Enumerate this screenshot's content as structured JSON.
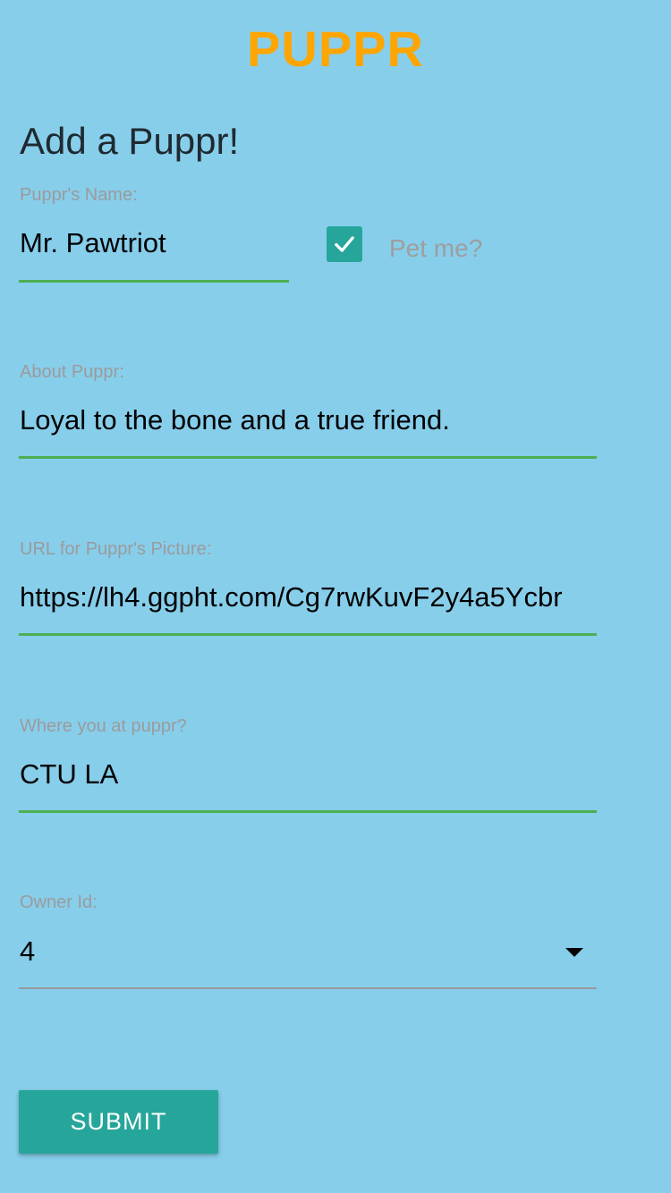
{
  "header": {
    "brand": "PUPPR"
  },
  "form": {
    "title": "Add a Puppr!",
    "name": {
      "label": "Puppr's Name:",
      "value": "Mr. Pawtriot"
    },
    "pet_me": {
      "label": "Pet me?",
      "checked": true
    },
    "about": {
      "label": "About Puppr:",
      "value": "Loyal to the bone and a true friend."
    },
    "picture_url": {
      "label": "URL for Puppr's Picture:",
      "value": "https://lh4.ggpht.com/Cg7rwKuvF2y4a5Ycbr"
    },
    "location": {
      "label": "Where you at puppr?",
      "value": "CTU LA"
    },
    "owner_id": {
      "label": "Owner Id:",
      "value": "4"
    },
    "submit_label": "SUBMIT"
  },
  "colors": {
    "background": "#87CEEB",
    "brand": "#FFA500",
    "accent": "#26A69A",
    "underline_active": "#4CAF50"
  }
}
